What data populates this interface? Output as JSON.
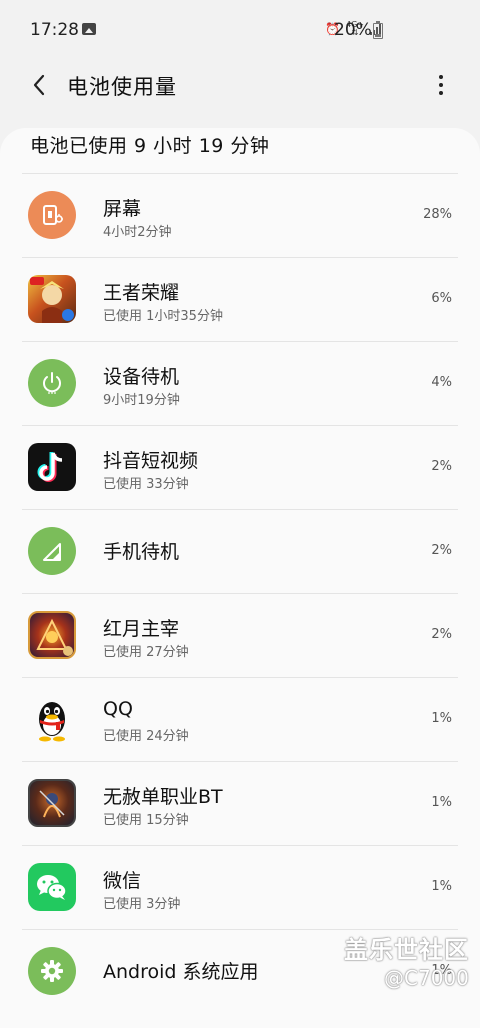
{
  "status_bar": {
    "time": "17:28",
    "network_label": "4G+",
    "battery_percent": "20%"
  },
  "header": {
    "title": "电池使用量"
  },
  "summary": "电池已使用 9 小时 19 分钟",
  "items": [
    {
      "name": "屏幕",
      "sub": "4小时2分钟",
      "percent": "28%",
      "icon": "screen-icon"
    },
    {
      "name": "王者荣耀",
      "sub": "已使用 1小时35分钟",
      "percent": "6%",
      "icon": "honor-of-kings-app-icon"
    },
    {
      "name": "设备待机",
      "sub": "9小时19分钟",
      "percent": "4%",
      "icon": "standby-power-icon"
    },
    {
      "name": "抖音短视频",
      "sub": "已使用 33分钟",
      "percent": "2%",
      "icon": "douyin-app-icon"
    },
    {
      "name": "手机待机",
      "sub": "",
      "percent": "2%",
      "icon": "cell-signal-icon"
    },
    {
      "name": "红月主宰",
      "sub": "已使用 27分钟",
      "percent": "2%",
      "icon": "red-moon-game-icon"
    },
    {
      "name": "QQ",
      "sub": "已使用 24分钟",
      "percent": "1%",
      "icon": "qq-penguin-icon"
    },
    {
      "name": "无赦单职业BT",
      "sub": "已使用 15分钟",
      "percent": "1%",
      "icon": "wushe-game-icon"
    },
    {
      "name": "微信",
      "sub": "已使用 3分钟",
      "percent": "1%",
      "icon": "wechat-icon"
    },
    {
      "name": "Android 系统应用",
      "sub": "",
      "percent": "1%",
      "icon": "android-settings-gear-icon"
    }
  ],
  "watermark": {
    "line1": "盖乐世社区",
    "line2": "@C7000"
  },
  "colors": {
    "screen": "#ec8b57",
    "green": "#7bbd5a",
    "wechat": "#22c95f"
  }
}
